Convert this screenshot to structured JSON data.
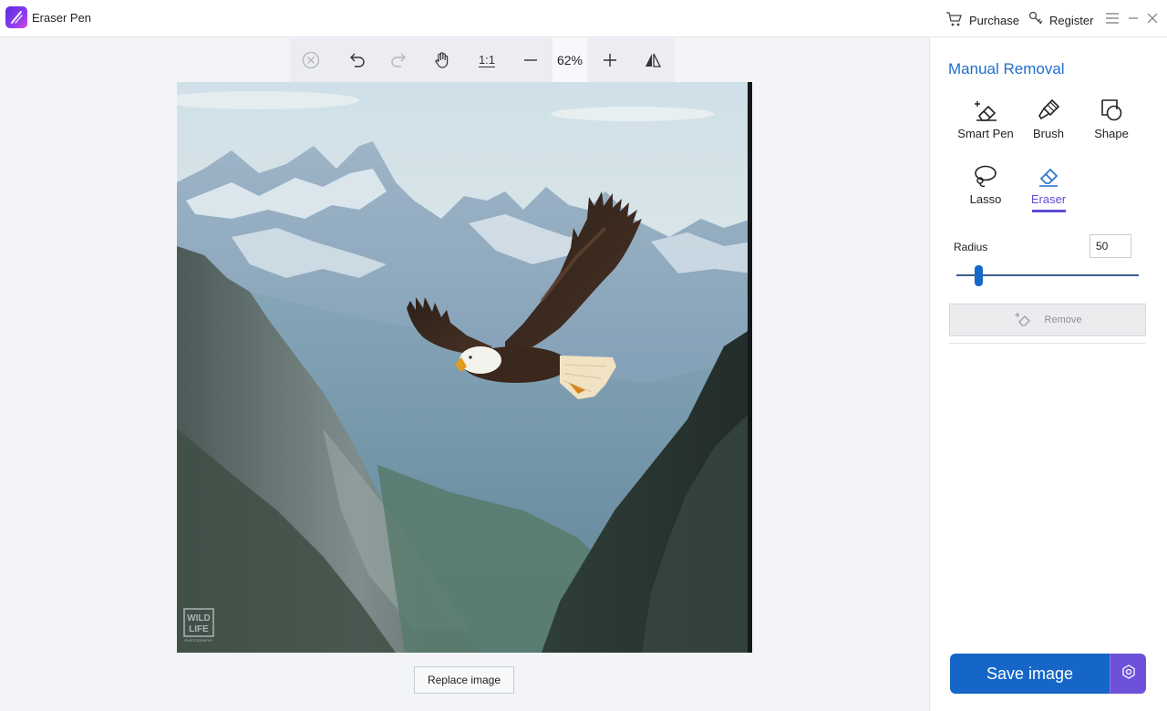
{
  "app": {
    "title": "Eraser Pen"
  },
  "titlebar": {
    "purchase_label": "Purchase",
    "register_label": "Register"
  },
  "toolbar": {
    "zoom": "62%",
    "actual_size_label": "1:1"
  },
  "canvas": {
    "replace_label": "Replace image",
    "watermark_line1": "WILD",
    "watermark_line2": "LIFE",
    "watermark_line3": "PHOTOGRAPHY"
  },
  "panel": {
    "title": "Manual Removal",
    "tools": [
      {
        "label": "Smart Pen"
      },
      {
        "label": "Brush"
      },
      {
        "label": "Shape"
      },
      {
        "label": "Lasso"
      },
      {
        "label": "Eraser"
      }
    ],
    "active_tool": "Eraser",
    "radius_label": "Radius",
    "radius_value": "50",
    "radius_fraction": 0.12,
    "remove_label": "Remove",
    "save_label": "Save image"
  },
  "colors": {
    "accent": "#1566c7",
    "active_tool": "#5b4ed6",
    "title": "#1f6fc9"
  }
}
